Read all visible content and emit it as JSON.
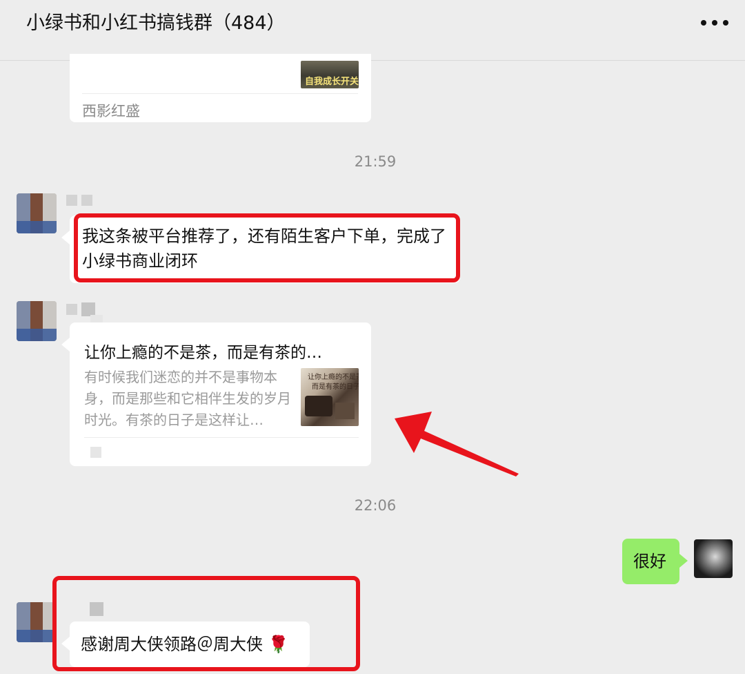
{
  "header": {
    "title": "小绿书和小红书搞钱群（484）",
    "more_icon": "more-dots-icon"
  },
  "messages": {
    "card1": {
      "thumb_label": "自我成长开关",
      "source": "西影红盛"
    },
    "time1": "21:59",
    "msg1": {
      "text": "我这条被平台推荐了，还有陌生客户下单，完成了小绿书商业闭环"
    },
    "card2": {
      "title": "让你上瘾的不是茶，而是有茶的…",
      "desc": "有时候我们迷恋的并不是事物本身，而是那些和它相伴生发的岁月时光。有茶的日子是这样让…",
      "thumb_line1": "让你上瘾的不是茶",
      "thumb_line2": "而是有茶的日子"
    },
    "time2": "22:06",
    "msg_self": {
      "text": "很好"
    },
    "msg3": {
      "text": "感谢周大侠领路＠周大侠 🌹"
    }
  },
  "annotations": {
    "highlight_color": "#e8141c"
  }
}
